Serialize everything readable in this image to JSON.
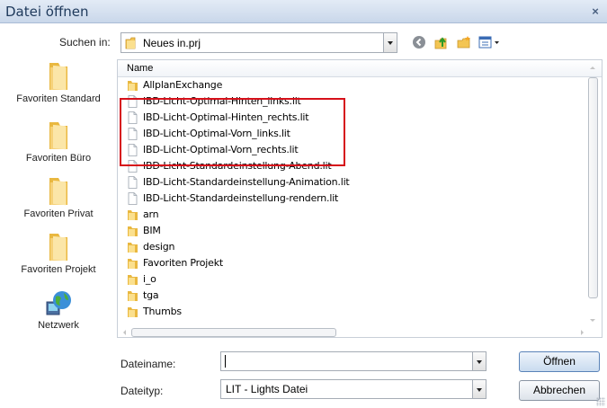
{
  "dialog": {
    "title": "Datei öffnen",
    "close_glyph": "×"
  },
  "lookin": {
    "label": "Suchen in:",
    "value": "Neues in.prj"
  },
  "toolbar": {
    "icons": [
      "back-icon",
      "up-folder-icon",
      "new-folder-icon",
      "view-menu-icon"
    ]
  },
  "places": [
    {
      "label": "Favoriten Standard",
      "icon": "folder-icon"
    },
    {
      "label": "Favoriten Büro",
      "icon": "folder-icon"
    },
    {
      "label": "Favoriten Privat",
      "icon": "folder-icon"
    },
    {
      "label": "Favoriten Projekt",
      "icon": "folder-icon"
    },
    {
      "label": "Netzwerk",
      "icon": "network-globe-icon"
    }
  ],
  "filelist": {
    "column_header": "Name",
    "items": [
      {
        "name": "AllplanExchange",
        "type": "folder"
      },
      {
        "name": "IBD-Licht-Optimal-Hinten_links.lit",
        "type": "file"
      },
      {
        "name": "IBD-Licht-Optimal-Hinten_rechts.lit",
        "type": "file"
      },
      {
        "name": "IBD-Licht-Optimal-Vorn_links.lit",
        "type": "file"
      },
      {
        "name": "IBD-Licht-Optimal-Vorn_rechts.lit",
        "type": "file"
      },
      {
        "name": "IBD-Licht-Standardeinstellung-Abend.lit",
        "type": "file"
      },
      {
        "name": "IBD-Licht-Standardeinstellung-Animation.lit",
        "type": "file"
      },
      {
        "name": "IBD-Licht-Standardeinstellung-rendern.lit",
        "type": "file"
      },
      {
        "name": "arn",
        "type": "folder"
      },
      {
        "name": "BIM",
        "type": "folder"
      },
      {
        "name": "design",
        "type": "folder"
      },
      {
        "name": "Favoriten Projekt",
        "type": "folder"
      },
      {
        "name": "i_o",
        "type": "folder"
      },
      {
        "name": "tga",
        "type": "folder"
      },
      {
        "name": "Thumbs",
        "type": "folder"
      }
    ],
    "highlighted_range": "IBD-Licht-Optimal files"
  },
  "filename": {
    "label": "Dateiname:",
    "value": ""
  },
  "filetype": {
    "label": "Dateityp:",
    "value": "LIT - Lights Datei"
  },
  "buttons": {
    "open": "Öffnen",
    "cancel": "Abbrechen"
  },
  "colors": {
    "title_text": "#1e395b",
    "highlight_border": "#d6101a",
    "folder_yellow": "#f3c553"
  }
}
